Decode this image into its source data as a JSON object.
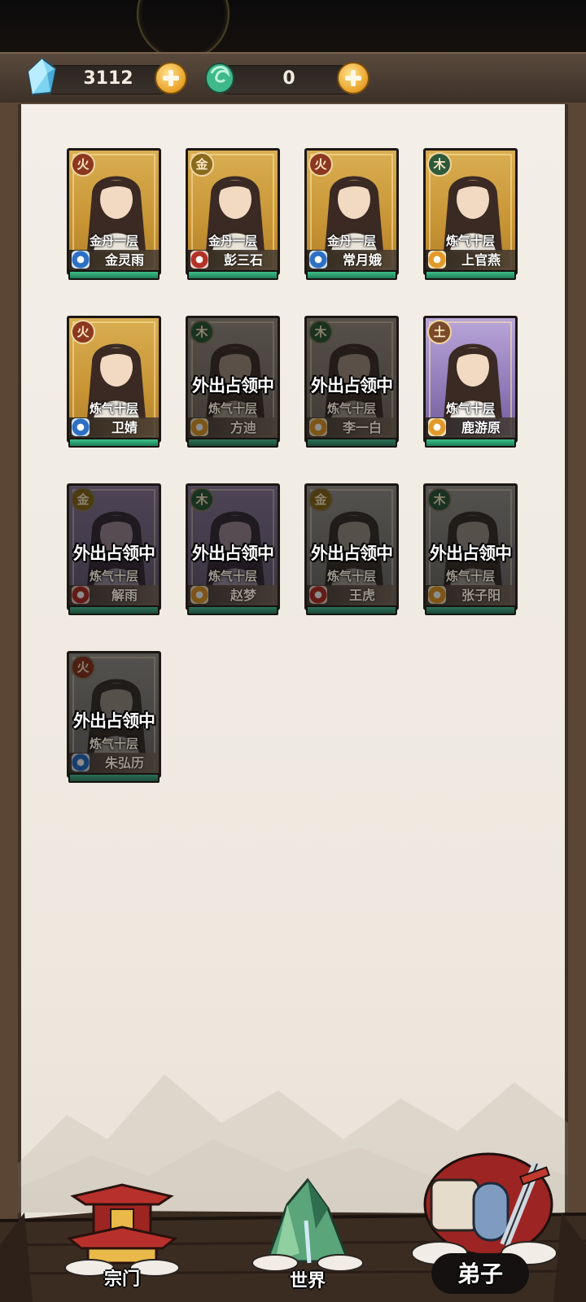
{
  "resources": {
    "spirit_stone": {
      "icon": "blue-crystal-icon",
      "value": "3112"
    },
    "jade": {
      "icon": "green-jade-icon",
      "value": "0"
    }
  },
  "status_overlay": "外出占领中",
  "disciples": [
    {
      "name": "金灵雨",
      "realm": "金丹一层",
      "element": "火",
      "rarity": "gold",
      "sect": "blue",
      "away": false
    },
    {
      "name": "彭三石",
      "realm": "金丹一层",
      "element": "金",
      "rarity": "gold",
      "sect": "red",
      "away": false
    },
    {
      "name": "常月娥",
      "realm": "金丹一层",
      "element": "火",
      "rarity": "gold",
      "sect": "blue",
      "away": false
    },
    {
      "name": "上官燕",
      "realm": "炼气十层",
      "element": "木",
      "rarity": "gold",
      "sect": "orange",
      "away": false
    },
    {
      "name": "卫婧",
      "realm": "炼气十层",
      "element": "火",
      "rarity": "gold",
      "sect": "blue",
      "away": false
    },
    {
      "name": "方迪",
      "realm": "炼气十层",
      "element": "木",
      "rarity": "dim-gold",
      "sect": "orange",
      "away": true
    },
    {
      "name": "李一白",
      "realm": "炼气十层",
      "element": "木",
      "rarity": "dim-gold",
      "sect": "orange",
      "away": true
    },
    {
      "name": "鹿游原",
      "realm": "炼气十层",
      "element": "土",
      "rarity": "purple",
      "sect": "orange",
      "away": false
    },
    {
      "name": "解雨",
      "realm": "炼气十层",
      "element": "金",
      "rarity": "dim-purple",
      "sect": "red",
      "away": true
    },
    {
      "name": "赵梦",
      "realm": "炼气十层",
      "element": "木",
      "rarity": "dim-purple",
      "sect": "orange",
      "away": true
    },
    {
      "name": "王虎",
      "realm": "炼气十层",
      "element": "金",
      "rarity": "dim-gray",
      "sect": "red",
      "away": true
    },
    {
      "name": "张子阳",
      "realm": "炼气十层",
      "element": "木",
      "rarity": "dim-gray",
      "sect": "orange",
      "away": true
    },
    {
      "name": "朱弘历",
      "realm": "炼气十层",
      "element": "火",
      "rarity": "dim-gray",
      "sect": "blue",
      "away": true
    }
  ],
  "nav": {
    "sect": {
      "label": "宗门",
      "icon": "pagoda-icon"
    },
    "world": {
      "label": "世界",
      "icon": "mountain-icon"
    },
    "disciples": {
      "label": "弟子",
      "icon": "scroll-sword-icon",
      "active": true
    }
  }
}
